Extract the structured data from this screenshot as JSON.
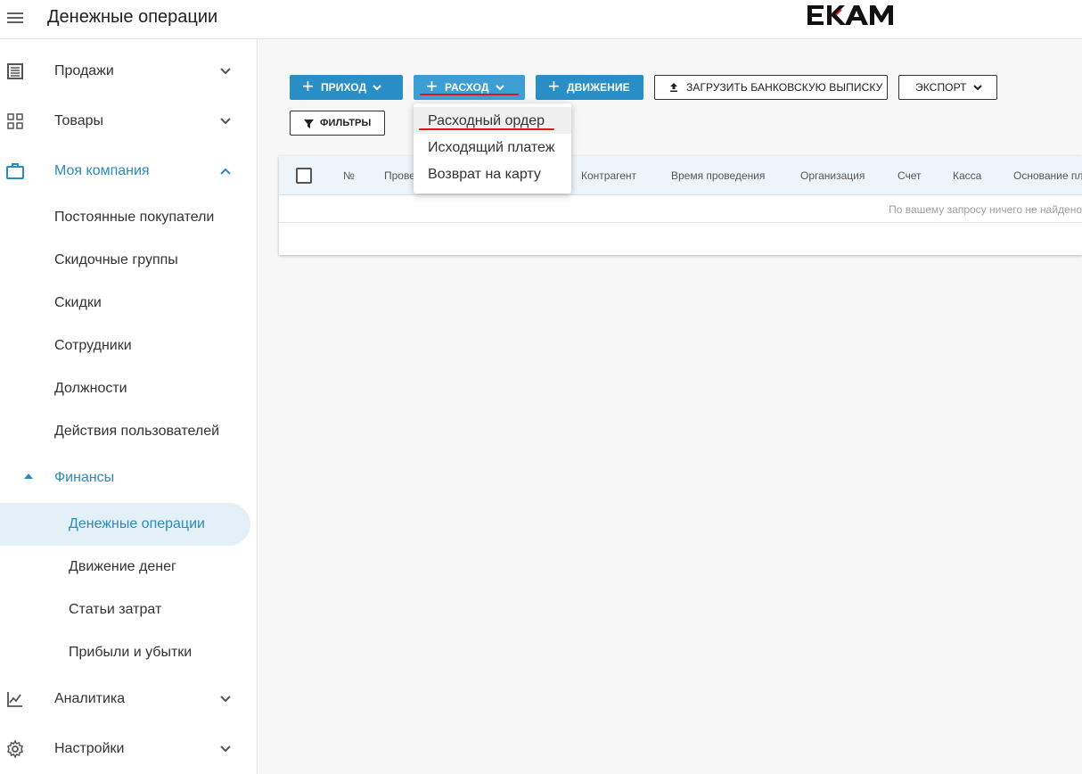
{
  "header": {
    "title": "Денежные операции",
    "logo": "EKAM"
  },
  "sidebar": {
    "items": [
      {
        "label": "Продажи",
        "icon": "list-icon"
      },
      {
        "label": "Товары",
        "icon": "grid-icon"
      },
      {
        "label": "Моя компания",
        "icon": "briefcase-icon",
        "expanded": true
      },
      {
        "label": "Аналитика",
        "icon": "chart-icon"
      },
      {
        "label": "Настройки",
        "icon": "gear-icon"
      }
    ],
    "company_sub": [
      "Постоянные покупатели",
      "Скидочные группы",
      "Скидки",
      "Сотрудники",
      "Должности",
      "Действия пользователей"
    ],
    "finance": {
      "label": "Финансы",
      "sub": [
        "Денежные операции",
        "Движение денег",
        "Статьи затрат",
        "Прибыли и убытки"
      ],
      "active": "Денежные операции"
    }
  },
  "toolbar": {
    "income": "ПРИХОД",
    "expense": "РАСХОД",
    "movement": "ДВИЖЕНИЕ",
    "upload": "ЗАГРУЗИТЬ БАНКОВСКУЮ ВЫПИСКУ",
    "export": "ЭКСПОРТ",
    "filters": "ФИЛЬТРЫ"
  },
  "table": {
    "columns": [
      "№",
      "Прове",
      "Контрагент",
      "Время проведения",
      "Организация",
      "Счет",
      "Касса",
      "Основание пл"
    ],
    "empty": "По вашему запросу ничего не найдено"
  },
  "dropdown": {
    "items": [
      "Расходный ордер",
      "Исходящий платеж",
      "Возврат на карту"
    ],
    "highlighted": "Расходный ордер"
  },
  "colors": {
    "accent": "#2a8fc7",
    "active_bg": "#e3f0f7",
    "annotation": "#e0161c"
  }
}
